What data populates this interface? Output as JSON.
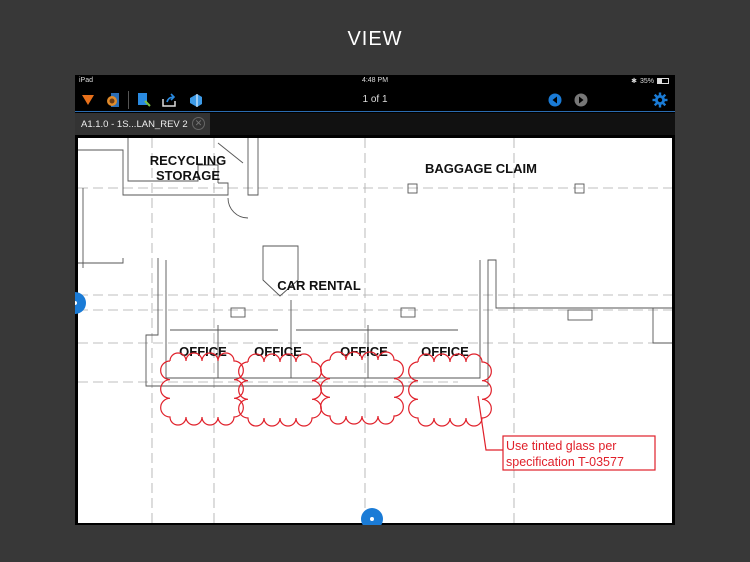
{
  "caption": "VIEW",
  "status": {
    "device": "iPad",
    "time": "4:48 PM",
    "battery": "35%",
    "battery_level": 0.35
  },
  "toolbar": {
    "page_indicator": "1 of 1"
  },
  "tabs": [
    {
      "label": "A1.1.0 - 1S...LAN_REV 2"
    }
  ],
  "drawing": {
    "rooms": [
      "RECYCLING",
      "STORAGE",
      "BAGGAGE CLAIM",
      "CAR RENTAL",
      "OFFICE",
      "OFFICE",
      "OFFICE",
      "OFFICE"
    ],
    "annotation": {
      "line1": "Use tinted glass per",
      "line2": "specification T-03577",
      "color": "#e0202a"
    }
  },
  "colors": {
    "accent": "#1a7bd6",
    "markup": "#e0202a"
  }
}
